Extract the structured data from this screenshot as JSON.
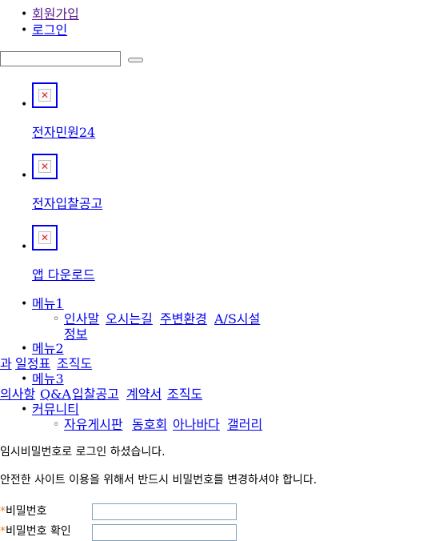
{
  "top_links": [
    {
      "label": "회원가입"
    },
    {
      "label": "로그인"
    }
  ],
  "search": {
    "value": "",
    "button_label": ""
  },
  "quick_links": [
    {
      "label": "전자민원24",
      "icon": "broken-image-icon"
    },
    {
      "label": "전자입찰공고",
      "icon": "broken-image-icon"
    },
    {
      "label": "앱 다운로드",
      "icon": "broken-image-icon"
    }
  ],
  "menus": [
    {
      "label": "메뉴1",
      "sub": [
        "인사말",
        "오시는길",
        "주변환경",
        "A/S시설",
        "정보"
      ]
    },
    {
      "label": "메뉴2",
      "sub": [
        "과",
        "일정표",
        "조직도"
      ]
    },
    {
      "label": "메뉴3",
      "sub": [
        "의사항",
        "Q&A",
        "입찰공고",
        "계약서",
        "조직도"
      ]
    },
    {
      "label": "커뮤니티",
      "sub": [
        "자유게시판",
        "동호회",
        "아나바다",
        "갤러리"
      ]
    }
  ],
  "notice": {
    "line1": "임시비밀번호로 로그인 하셨습니다.",
    "line2": "안전한 사이트 이용을 위해서 반드시 비밀번호를 변경하셔야 합니다."
  },
  "form": {
    "required_mark": "*",
    "password_label": "비밀번호",
    "password_value": "",
    "confirm_label": "비밀번호 확인",
    "confirm_value": ""
  },
  "colors": {
    "link": "#0000ee",
    "visited": "#551a8b",
    "required": "#e87a1e"
  }
}
